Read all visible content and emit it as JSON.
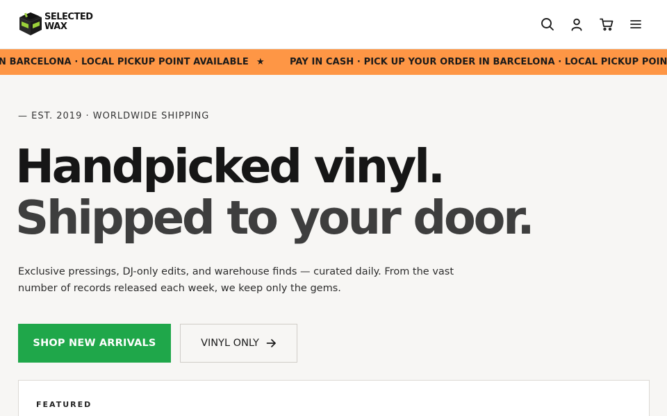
{
  "brand": {
    "logo_line1": "SELECTED",
    "logo_line2": "WAX"
  },
  "header_icons": [
    "search-icon",
    "user-icon",
    "cart-icon",
    "menu-icon"
  ],
  "ticker": {
    "items": [
      "N BARCELONA · LOCAL PICKUP POINT AVAILABLE",
      "★",
      "PAY IN CASH · PICK UP YOUR ORDER IN BARCELONA · LOCAL PICKUP POINT AVA"
    ]
  },
  "hero": {
    "eyebrow": "— EST. 2019 · WORLDWIDE SHIPPING",
    "headline_1": "Handpicked vinyl.",
    "headline_2": "Shipped to your door.",
    "lede": "Exclusive pressings, DJ-only edits, and warehouse finds — curated daily. From the vast number of records released each week, we keep only the gems.",
    "primary_cta": "SHOP NEW ARRIVALS",
    "secondary_cta": "VINYL ONLY"
  },
  "featured": {
    "label": "FEATURED"
  },
  "colors": {
    "accent_green": "#1fa74a",
    "ticker_orange": "#fe9645",
    "logo_green": "#9bd13a",
    "page_bg": "#f7f6f4"
  }
}
